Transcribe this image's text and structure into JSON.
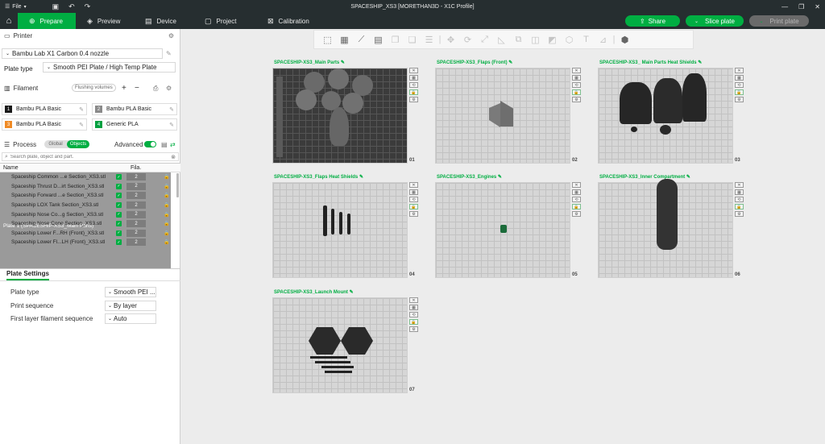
{
  "titlebar": {
    "menu_label": "File",
    "window_title": "SPACESHIP_XS3 [MORETHAN3D - X1C Profile]"
  },
  "nav": {
    "tabs": [
      {
        "label": "Prepare",
        "icon": "cube-plus-icon"
      },
      {
        "label": "Preview",
        "icon": "preview-icon"
      },
      {
        "label": "Device",
        "icon": "device-icon"
      },
      {
        "label": "Project",
        "icon": "project-icon"
      },
      {
        "label": "Calibration",
        "icon": "calibration-icon"
      }
    ],
    "share_label": "Share",
    "slice_label": "Slice plate",
    "print_label": "Print plate"
  },
  "printer": {
    "section_label": "Printer",
    "printer_name": "Bambu Lab X1 Carbon 0.4 nozzle",
    "plate_type_label": "Plate type",
    "plate_type_value": "Smooth PEI Plate / High Temp Plate"
  },
  "filament": {
    "section_label": "Filament",
    "flushing_label": "Flushing volumes",
    "slots": [
      {
        "num": "1",
        "name": "Bambu PLA Basic",
        "color": "#1a1a1a"
      },
      {
        "num": "2",
        "name": "Bambu PLA Basic",
        "color": "#8a8a8a"
      },
      {
        "num": "3",
        "name": "Bambu PLA Basic",
        "color": "#f08a24"
      },
      {
        "num": "4",
        "name": "Generic PLA",
        "color": "#00a040"
      }
    ]
  },
  "process": {
    "section_label": "Process",
    "global_label": "Global",
    "objects_label": "Objects",
    "advanced_label": "Advanced",
    "search_placeholder": "Search plate, object and part."
  },
  "objects": {
    "col_name": "Name",
    "col_fila": "Fila.",
    "rows": [
      {
        "type": "plate",
        "name": "Plate 1 (SPACESHIP-XS3_Main Parts)",
        "selected": true
      },
      {
        "type": "obj",
        "name": "Spaceship Common ...e Section_XS3.stl",
        "fila": "2"
      },
      {
        "type": "obj",
        "name": "Spaceship Thrust D...irt Section_XS3.stl",
        "fila": "2"
      },
      {
        "type": "obj",
        "name": "Spaceship Forward ...e Section_XS3.stl",
        "fila": "2"
      },
      {
        "type": "obj",
        "name": "Spaceship LOX Tank Section_XS3.stl",
        "fila": "2"
      },
      {
        "type": "obj",
        "name": "Spaceship Nose Co...g Section_XS3.stl",
        "fila": "2"
      },
      {
        "type": "obj",
        "name": "Spaceship Nose Cone Section_XS3.stl",
        "fila": "2"
      },
      {
        "type": "plate",
        "name": "Plate 2 (SPACESHIP-XS3_Flaps (Front))",
        "selected": false
      },
      {
        "type": "obj",
        "name": "Spaceship Lower F...RH (Front)_XS3.stl",
        "fila": "2"
      },
      {
        "type": "obj",
        "name": "Spaceship Lower Fl...LH (Front)_XS3.stl",
        "fila": "2"
      }
    ]
  },
  "plate_settings": {
    "tab_label": "Plate Settings",
    "rows": [
      {
        "label": "Plate type",
        "value": "Smooth PEI ..."
      },
      {
        "label": "Print sequence",
        "value": "By layer"
      },
      {
        "label": "First layer filament sequence",
        "value": "Auto"
      }
    ]
  },
  "plates": [
    {
      "name": "SPACESHIP-XS3_Main Parts",
      "num": "01"
    },
    {
      "name": "SPACESHIP-XS3_Flaps (Front)",
      "num": "02"
    },
    {
      "name": "SPACESHIP-XS3_ Main Parts Heat Shields",
      "num": "03"
    },
    {
      "name": "SPACESHIP-XS3_Flaps Heat Shields",
      "num": "04"
    },
    {
      "name": "SPACESHIP-XS3_Engines",
      "num": "05"
    },
    {
      "name": "SPACESHIP-XS3_Inner Compartment",
      "num": "06"
    },
    {
      "name": "SPACESHIP-XS3_Launch Mount",
      "num": "07"
    }
  ],
  "colors": {
    "accent": "#00ae42",
    "titlebar": "#262e30"
  }
}
